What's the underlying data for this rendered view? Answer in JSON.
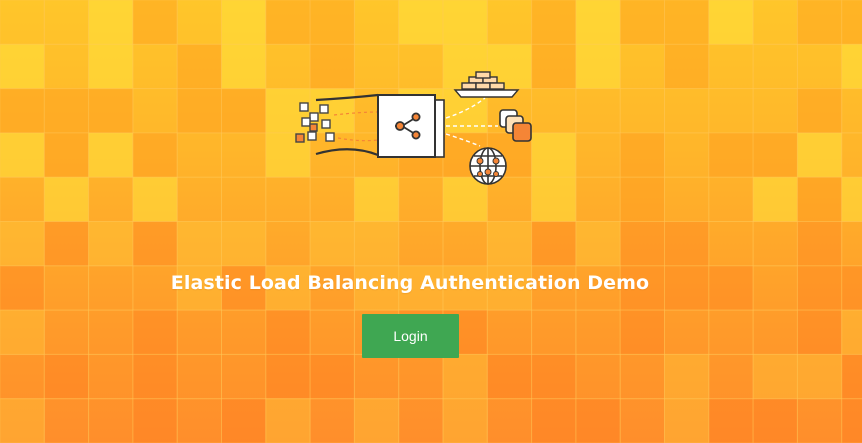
{
  "page": {
    "title": "Elastic Load Balancing Authentication Demo"
  },
  "login_button": {
    "label": "Login"
  },
  "hero": {
    "icon": "load-balancer-icon"
  },
  "colors": {
    "background_top": "#ffc62a",
    "background_bottom": "#ff8e2b",
    "button": "#3fa752",
    "accent": "#f58536"
  }
}
